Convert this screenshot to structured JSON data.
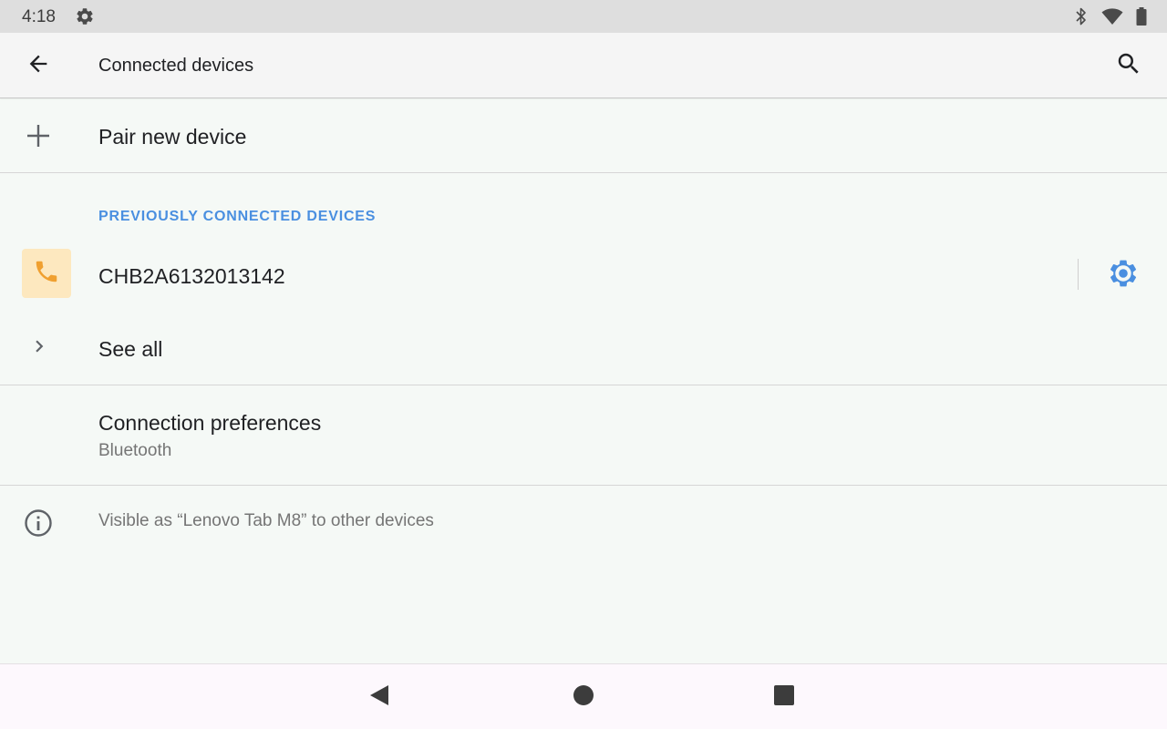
{
  "status_bar": {
    "time": "4:18",
    "left_icon": "gear-icon",
    "right_icons": [
      "bluetooth-icon",
      "wifi-icon",
      "battery-icon"
    ]
  },
  "app_bar": {
    "title": "Connected devices",
    "back_icon": "back-arrow-icon",
    "search_icon": "search-icon"
  },
  "pair": {
    "label": "Pair new device",
    "icon": "plus-icon"
  },
  "previously_connected": {
    "header": "PREVIOUSLY CONNECTED DEVICES",
    "devices": [
      {
        "name": "CHB2A6132013142",
        "icon": "phone-icon",
        "settings_icon": "gear-icon"
      }
    ],
    "see_all_label": "See all"
  },
  "connection_preferences": {
    "title": "Connection preferences",
    "summary": "Bluetooth"
  },
  "footer_info": {
    "text": "Visible as “Lenovo Tab M8” to other devices",
    "icon": "info-icon"
  },
  "colors": {
    "accent": "#4a8fe0",
    "device_icon_bg": "#fde8bf",
    "device_icon": "#f0a030",
    "background": "#f5f9f6"
  },
  "nav_bar": {
    "buttons": [
      "back-triangle-icon",
      "home-circle-icon",
      "recents-square-icon"
    ]
  }
}
